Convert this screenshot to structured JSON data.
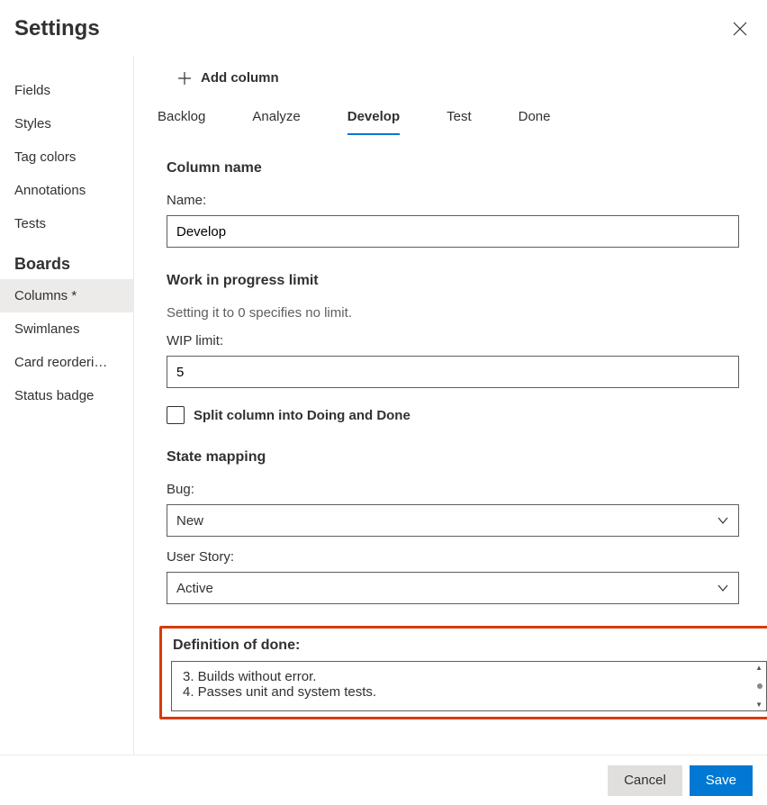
{
  "header": {
    "title": "Settings"
  },
  "sidebar": {
    "items": [
      {
        "label": "Fields"
      },
      {
        "label": "Styles"
      },
      {
        "label": "Tag colors"
      },
      {
        "label": "Annotations"
      },
      {
        "label": "Tests"
      }
    ],
    "group": "Boards",
    "groupItems": [
      {
        "label": "Columns *",
        "active": true
      },
      {
        "label": "Swimlanes"
      },
      {
        "label": "Card reorderi…"
      },
      {
        "label": "Status badge"
      }
    ]
  },
  "add_row": {
    "label": "Add column"
  },
  "tabs": [
    {
      "label": "Backlog"
    },
    {
      "label": "Analyze"
    },
    {
      "label": "Develop",
      "active": true
    },
    {
      "label": "Test"
    },
    {
      "label": "Done"
    }
  ],
  "column_name": {
    "heading": "Column name",
    "name_label": "Name:",
    "name_value": "Develop"
  },
  "wip": {
    "heading": "Work in progress limit",
    "hint": "Setting it to 0 specifies no limit.",
    "limit_label": "WIP limit:",
    "limit_value": "5",
    "split_label": "Split column into Doing and Done"
  },
  "state_mapping": {
    "heading": "State mapping",
    "bug_label": "Bug:",
    "bug_value": "New",
    "user_story_label": "User Story:",
    "user_story_value": "Active"
  },
  "dod": {
    "heading": "Definition of done:",
    "lines": [
      "3. Builds without error.",
      "4. Passes unit and system tests."
    ]
  },
  "footer": {
    "cancel": "Cancel",
    "save": "Save"
  }
}
